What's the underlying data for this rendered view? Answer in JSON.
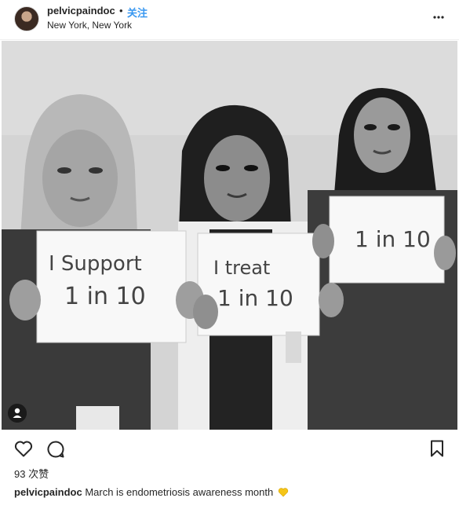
{
  "header": {
    "username": "pelvicpaindoc",
    "separator": "•",
    "follow_label": "关注",
    "location": "New York, New York",
    "more_icon": "more-horizontal-icon"
  },
  "photo": {
    "signs": [
      {
        "line1": "I Support",
        "line2": "1 in 10"
      },
      {
        "line1": "I treat",
        "line2": "1 in 10"
      },
      {
        "line1": "1 in 10"
      }
    ],
    "tag_icon": "person-tag-icon"
  },
  "actions": {
    "like_icon": "heart-icon",
    "comment_icon": "comment-icon",
    "save_icon": "bookmark-icon"
  },
  "likes": "93 次赞",
  "caption": {
    "username": "pelvicpaindoc",
    "text": "March is endometriosis awareness month"
  },
  "colors": {
    "link": "#3897f0",
    "text": "#262626",
    "emoji_heart": "#f5c518"
  }
}
